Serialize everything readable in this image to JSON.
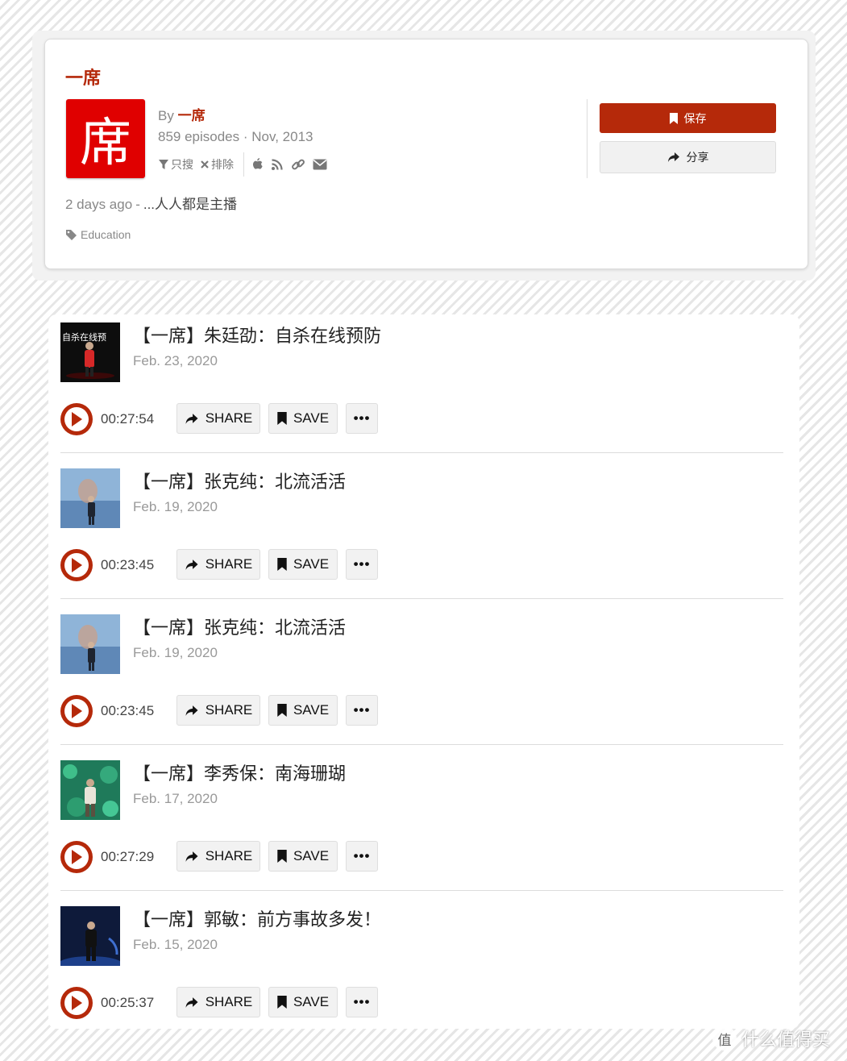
{
  "podcast": {
    "title": "一席",
    "cover_char": "席",
    "by_prefix": "By",
    "author": "一席",
    "meta": "859 episodes · Nov, 2013",
    "tools": {
      "filter_label": "只搜",
      "exclude_label": "排除"
    },
    "latest": {
      "when": "2 days ago",
      "dash": "-",
      "desc": "...人人都是主播"
    },
    "category": "Education",
    "save_label": "保存",
    "share_label": "分享",
    "accent_color": "#b5290a"
  },
  "episodes": [
    {
      "title": "【一席】朱廷劭：自杀在线预防",
      "date": "Feb. 23, 2020",
      "duration": "00:27:54",
      "thumb_text": "自杀在线预"
    },
    {
      "title": "【一席】张克纯：北流活活",
      "date": "Feb. 19, 2020",
      "duration": "00:23:45"
    },
    {
      "title": "【一席】张克纯：北流活活",
      "date": "Feb. 19, 2020",
      "duration": "00:23:45"
    },
    {
      "title": "【一席】李秀保：南海珊瑚",
      "date": "Feb. 17, 2020",
      "duration": "00:27:29"
    },
    {
      "title": "【一席】郭敏：前方事故多发！",
      "date": "Feb. 15, 2020",
      "duration": "00:25:37"
    }
  ],
  "actions": {
    "share": "SHARE",
    "save": "SAVE",
    "more": "•••"
  },
  "watermark": {
    "logo": "值",
    "text": "什么值得买"
  }
}
